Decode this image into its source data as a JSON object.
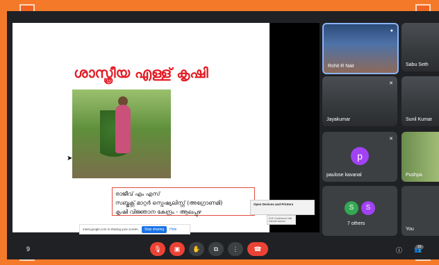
{
  "slide": {
    "title": "ശാസ്ത്രീയ എള്ള് കൃഷി",
    "caption_lines": [
      "രാജീവ് എം എസ്",
      "സബ്ജക്റ്റ് മാറ്റർ സ്പെഷ്യലിസ്റ്റ് (അഗ്രോണമി)",
      "കൃഷി വിജ്ഞാന കേന്ദ്രം - ആലപ്പുഴ"
    ]
  },
  "share_bar": {
    "message": "meet.google.com is sharing your screen.",
    "stop_label": "Stop sharing",
    "hide_label": "Hide"
  },
  "popup": {
    "label": "Open Devices and Printers",
    "sub_label": "KVK Conference Hall Internet access"
  },
  "participants": [
    {
      "name": "Rohit R Nair",
      "speaking": true
    },
    {
      "name": "Sabu Seth"
    },
    {
      "name": "Jayakumar",
      "muted": true
    },
    {
      "name": "Sunil Kumar"
    },
    {
      "name": "paulose kavanal",
      "initial": "p",
      "muted": true,
      "color": "#a142f4"
    },
    {
      "name": "Pushpa"
    },
    {
      "name": "7 others",
      "initials": [
        "S",
        "S"
      ],
      "colors": [
        "#34a853",
        "#a142f4"
      ]
    },
    {
      "name": "You"
    }
  ],
  "controls": {
    "participant_count": "16",
    "left_label": "9"
  }
}
